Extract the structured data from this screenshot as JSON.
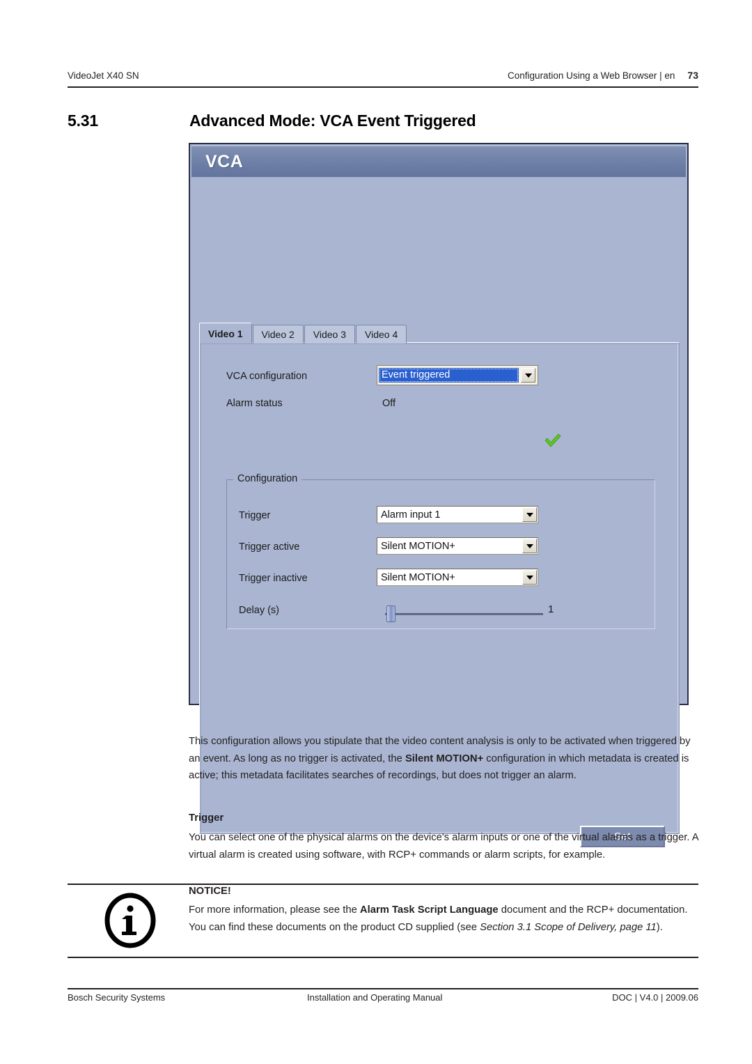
{
  "header": {
    "product": "VideoJet X40 SN",
    "chapter": "Configuration Using a Web Browser | en",
    "page_number": "73"
  },
  "section": {
    "number": "5.31",
    "title": "Advanced Mode: VCA Event Triggered"
  },
  "screenshot": {
    "window_title": "VCA",
    "tabs": [
      {
        "label": "Video 1",
        "active": true
      },
      {
        "label": "Video 2",
        "active": false
      },
      {
        "label": "Video 3",
        "active": false
      },
      {
        "label": "Video 4",
        "active": false
      }
    ],
    "fields": {
      "vca_configuration_label": "VCA configuration",
      "vca_configuration_value": "Event triggered",
      "alarm_status_label": "Alarm status",
      "alarm_status_value": "Off"
    },
    "configuration_group": {
      "legend": "Configuration",
      "trigger_label": "Trigger",
      "trigger_value": "Alarm input 1",
      "trigger_active_label": "Trigger active",
      "trigger_active_value": "Silent MOTION+",
      "trigger_inactive_label": "Trigger inactive",
      "trigger_inactive_value": "Silent MOTION+",
      "delay_label": "Delay (s)",
      "delay_value": "1"
    },
    "set_button_label": "Set",
    "colors": {
      "panel_background": "#a9b5d1",
      "title_bar": "#6d7fa6",
      "selection_highlight": "#2a5fcf",
      "checkmark_green": "#5ec523",
      "set_button": "#7d8cae"
    }
  },
  "body": {
    "paragraph1_part1": "This configuration allows you stipulate that the video content analysis is only to be activated when triggered by an event. As long as no trigger is activated, the ",
    "paragraph1_bold": "Silent MOTION+",
    "paragraph1_part2": " configuration in which metadata is created is active; this metadata facilitates searches of recordings, but does not trigger an alarm.",
    "trigger_subhead": "Trigger",
    "paragraph2": "You can select one of the physical alarms on the device's alarm inputs or one of the virtual alarms as a trigger. A virtual alarm is created using software, with RCP+ commands or alarm scripts, for example."
  },
  "notice": {
    "title": "NOTICE!",
    "part1": "For more information, please see the ",
    "bold": "Alarm Task Script Language",
    "part2": " document and the RCP+ documentation. You can find these documents on the product CD supplied (see ",
    "italic": "Section 3.1 Scope of Delivery, page 11",
    "part3": ")."
  },
  "footer": {
    "left": "Bosch Security Systems",
    "center": "Installation and Operating Manual",
    "right": "DOC | V4.0 | 2009.06"
  }
}
